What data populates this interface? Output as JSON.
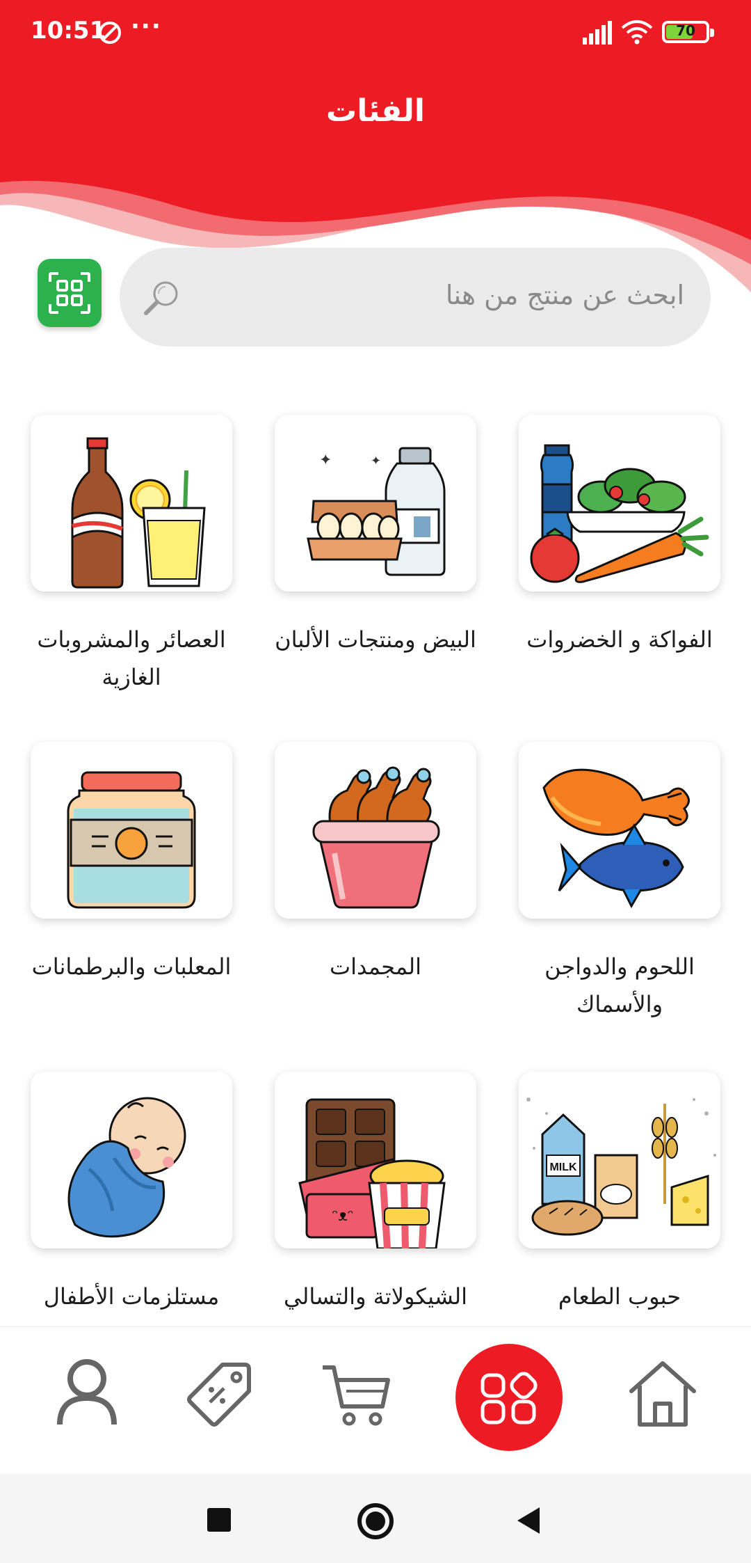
{
  "status_bar": {
    "time": "10:51",
    "dots": "···",
    "battery_level": 70,
    "battery_label": "70"
  },
  "header": {
    "title": "الفئات",
    "color": "#ed1c24"
  },
  "search": {
    "placeholder": "ابحث عن منتج من هنا"
  },
  "qr_button": {
    "icon": "qr-code-icon",
    "color": "#2bb24c"
  },
  "categories": [
    {
      "label": "الفواكة و الخضروات",
      "icon": "vegetables-icon"
    },
    {
      "label": "البيض ومنتجات الألبان",
      "icon": "eggs-milk-icon"
    },
    {
      "label": "العصائر والمشروبات الغازية",
      "icon": "drinks-icon"
    },
    {
      "label": "اللحوم والدواجن والأسماك",
      "icon": "meat-fish-icon"
    },
    {
      "label": "المجمدات",
      "icon": "frozen-chicken-icon"
    },
    {
      "label": "المعلبات والبرطمانات",
      "icon": "jar-icon"
    },
    {
      "label": "حبوب الطعام",
      "icon": "grains-icon"
    },
    {
      "label": "الشيكولاتة والتسالي",
      "icon": "chocolate-snacks-icon"
    },
    {
      "label": "مستلزمات الأطفال",
      "icon": "baby-icon"
    }
  ],
  "bottom_nav": {
    "items": [
      {
        "name": "profile",
        "icon": "user-icon"
      },
      {
        "name": "offers",
        "icon": "discount-tag-icon"
      },
      {
        "name": "cart",
        "icon": "cart-icon"
      },
      {
        "name": "categories",
        "icon": "categories-icon",
        "active": true
      },
      {
        "name": "home",
        "icon": "home-icon"
      }
    ]
  }
}
